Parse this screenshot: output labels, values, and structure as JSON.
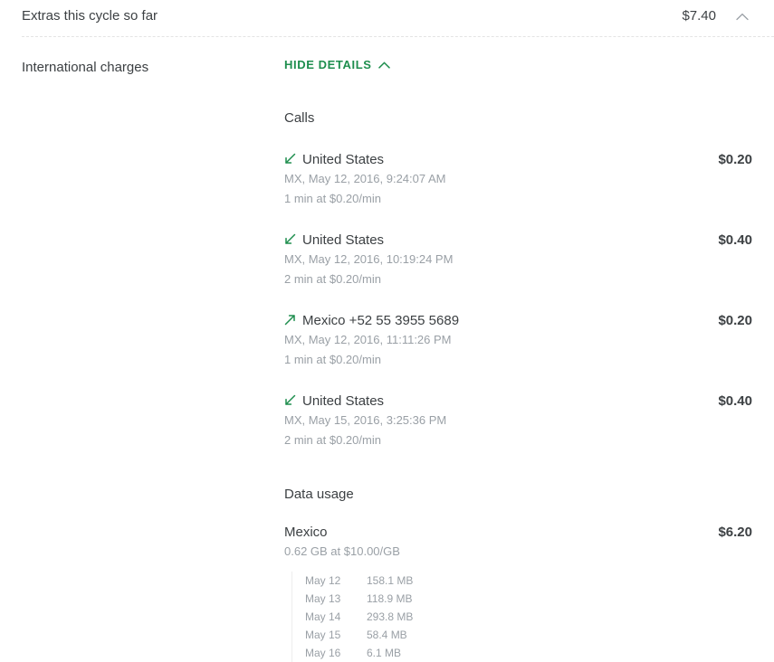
{
  "summary": {
    "title": "Extras this cycle so far",
    "amount": "$7.40",
    "collapse_icon": "chevron-up-icon"
  },
  "detail": {
    "label": "International charges",
    "toggle_label": "HIDE DETAILS",
    "toggle_icon": "chevron-up-icon"
  },
  "colors": {
    "accent_green": "#1e8e4e",
    "text_primary": "#3c4043",
    "text_secondary": "#9aa0a6",
    "divider": "#e4e4e4"
  },
  "calls": {
    "heading": "Calls",
    "items": [
      {
        "direction_icon": "arrow-incoming-icon",
        "direction": "incoming",
        "destination": "United States",
        "timestamp": "MX, May 12, 2016, 9:24:07 AM",
        "rate_line": "1 min at $0.20/min",
        "amount": "$0.20"
      },
      {
        "direction_icon": "arrow-incoming-icon",
        "direction": "incoming",
        "destination": "United States",
        "timestamp": "MX, May 12, 2016, 10:19:24 PM",
        "rate_line": "2 min at $0.20/min",
        "amount": "$0.40"
      },
      {
        "direction_icon": "arrow-outgoing-icon",
        "direction": "outgoing",
        "destination": "Mexico +52 55 3955 5689",
        "timestamp": "MX, May 12, 2016, 11:11:26 PM",
        "rate_line": "1 min at $0.20/min",
        "amount": "$0.20"
      },
      {
        "direction_icon": "arrow-incoming-icon",
        "direction": "incoming",
        "destination": "United States",
        "timestamp": "MX, May 15, 2016, 3:25:36 PM",
        "rate_line": "2 min at $0.20/min",
        "amount": "$0.40"
      }
    ]
  },
  "data_usage": {
    "heading": "Data usage",
    "country": "Mexico",
    "rate_line": "0.62 GB at $10.00/GB",
    "amount": "$6.20",
    "daily": [
      {
        "date": "May 12",
        "value": "158.1 MB"
      },
      {
        "date": "May 13",
        "value": "118.9 MB"
      },
      {
        "date": "May 14",
        "value": "293.8 MB"
      },
      {
        "date": "May 15",
        "value": "58.4 MB"
      },
      {
        "date": "May 16",
        "value": "6.1 MB"
      }
    ]
  }
}
